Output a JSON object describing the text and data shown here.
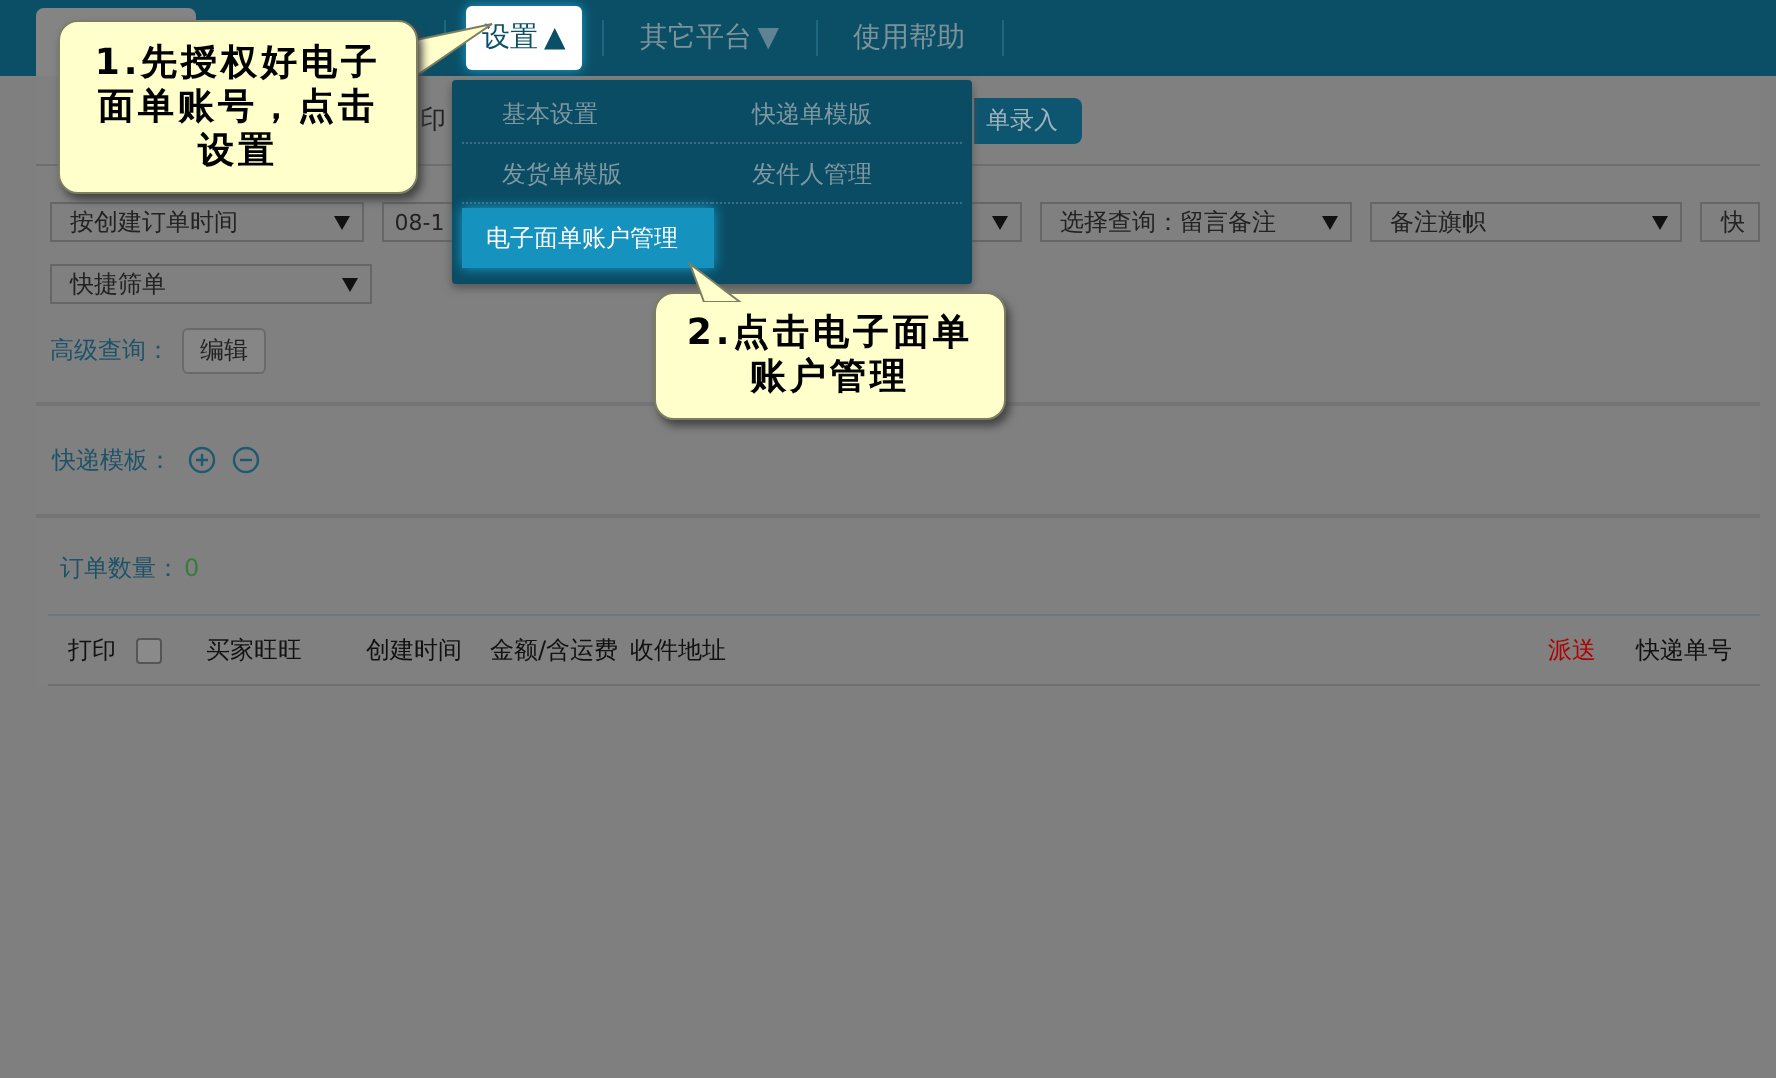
{
  "nav": {
    "items": [
      {
        "label": "设置",
        "caret": "▲",
        "selected": true
      },
      {
        "label": "其它平台",
        "caret": "▼",
        "selected": false
      },
      {
        "label": "使用帮助",
        "selected": false
      }
    ]
  },
  "menu": {
    "items": [
      {
        "label": "基本设置",
        "selected": false
      },
      {
        "label": "快递单模版",
        "selected": false
      },
      {
        "label": "发货单模版",
        "selected": false
      },
      {
        "label": "发件人管理",
        "selected": false
      },
      {
        "label": "电子面单账户管理",
        "selected": true
      }
    ]
  },
  "toolbar": {
    "print_fragment": "印",
    "button": "单录入"
  },
  "filters": [
    {
      "kind": "select",
      "value": "按创建订单时间"
    },
    {
      "kind": "select",
      "value": "08-1"
    },
    {
      "kind": "select"
    },
    {
      "kind": "select",
      "value": "选择查询：留言备注"
    },
    {
      "kind": "select",
      "value": "备注旗帜"
    },
    {
      "kind": "select",
      "value": "快"
    },
    {
      "kind": "select",
      "value": "快捷筛单"
    }
  ],
  "advanced": {
    "label": "高级查询：",
    "button": "编辑"
  },
  "templates": {
    "label": "快递模板："
  },
  "orders": {
    "label": "订单数量：",
    "count": "0"
  },
  "table": {
    "columns": [
      {
        "label": "打印"
      },
      {
        "kind": "checkbox",
        "checked": false
      },
      {
        "label": "买家旺旺"
      },
      {
        "label": "创建时间"
      },
      {
        "label": "金额/含运费"
      },
      {
        "label": "收件地址"
      },
      {
        "label": "派送",
        "color": "#b00000"
      },
      {
        "label": "快递单号"
      }
    ]
  },
  "callouts": [
    {
      "text": "1.先授权好电子面单账号，点击设置"
    },
    {
      "text": "2.点击电子面单账户管理"
    }
  ]
}
